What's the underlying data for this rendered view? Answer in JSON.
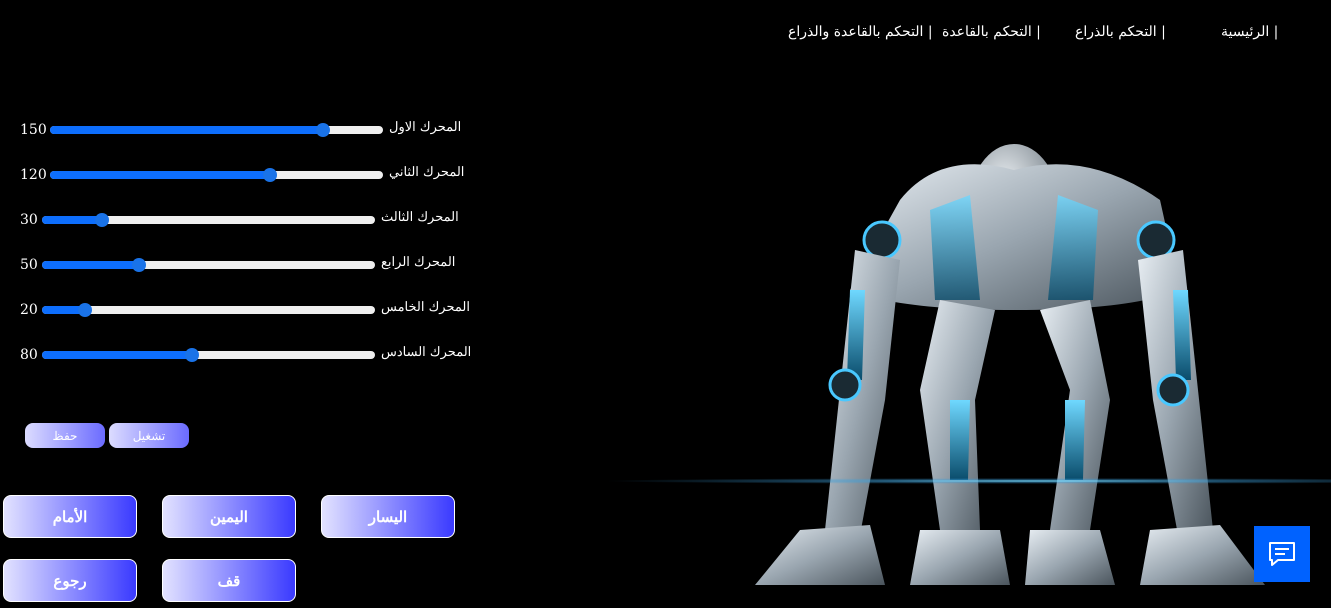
{
  "nav": {
    "home": "| الرئيسية",
    "arm": "| التحكم بالذراع",
    "base": "| التحكم بالقاعدة",
    "base_arm": "| التحكم بالقاعدة والذراع"
  },
  "motors": [
    {
      "label": "المحرك الاول",
      "value": "150",
      "level": 0.82
    },
    {
      "label": "المحرك الثاني",
      "value": "120",
      "level": 0.66
    },
    {
      "label": "المحرك الثالث",
      "value": "30",
      "level": 0.18
    },
    {
      "label": "المحرك الرابع",
      "value": "50",
      "level": 0.29
    },
    {
      "label": "المحرك الخامس",
      "value": "20",
      "level": 0.13
    },
    {
      "label": "المحرك السادس",
      "value": "80",
      "level": 0.45
    }
  ],
  "actions": {
    "save": "حفظ",
    "run": "تشغيل"
  },
  "controls": {
    "forward": "الأمام",
    "right": "اليمين",
    "left": "اليسار",
    "back": "رجوع",
    "stop": "قف"
  },
  "colors": {
    "slider_fill": "#0d6efd",
    "chat_button": "#0062ff",
    "button_gradient_start": "#e2e2ff",
    "button_gradient_end": "#3a3aff"
  },
  "icons": {
    "chat": "chat-icon"
  }
}
